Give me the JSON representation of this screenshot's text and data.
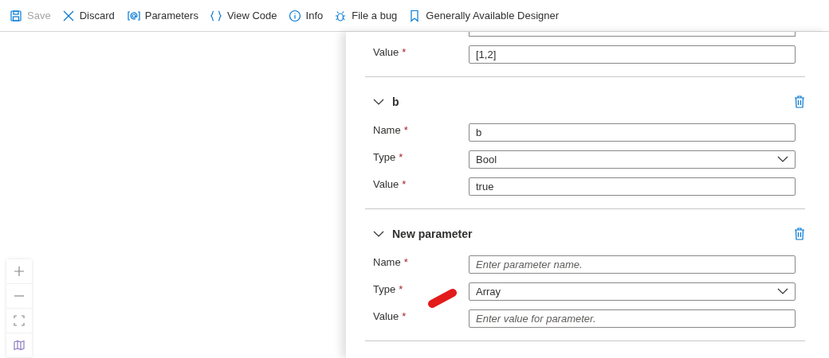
{
  "toolbar": [
    {
      "kind": "save",
      "label": "Save",
      "disabled": true
    },
    {
      "kind": "discard",
      "label": "Discard",
      "disabled": false
    },
    {
      "kind": "parameters",
      "label": "Parameters",
      "disabled": false
    },
    {
      "kind": "code",
      "label": "View Code",
      "disabled": false
    },
    {
      "kind": "info",
      "label": "Info",
      "disabled": false
    },
    {
      "kind": "bug",
      "label": "File a bug",
      "disabled": false
    },
    {
      "kind": "bookmark",
      "label": "Generally Available Designer",
      "disabled": false
    }
  ],
  "partial_section": {
    "fields": [
      {
        "kind": "text",
        "label": "Value",
        "required_mark": "*",
        "value": "[1,2]"
      }
    ]
  },
  "sections": [
    {
      "title": "b",
      "expanded": true,
      "fields": [
        {
          "kind": "text",
          "label": "Name",
          "required_mark": "*",
          "value": "b"
        },
        {
          "kind": "select",
          "label": "Type",
          "required_mark": "*",
          "value": "Bool"
        },
        {
          "kind": "text",
          "label": "Value",
          "required_mark": "*",
          "value": "true"
        }
      ]
    },
    {
      "title": "New parameter",
      "expanded": true,
      "fields": [
        {
          "kind": "text",
          "label": "Name",
          "required_mark": "*",
          "placeholder": "Enter parameter name."
        },
        {
          "kind": "select",
          "label": "Type",
          "required_mark": "*",
          "value": "Array"
        },
        {
          "kind": "text",
          "label": "Value",
          "required_mark": "*",
          "placeholder": "Enter value for parameter."
        }
      ]
    }
  ],
  "canvas_controls": [
    {
      "kind": "zoom_in"
    },
    {
      "kind": "zoom_out"
    },
    {
      "kind": "fit"
    },
    {
      "kind": "minimap"
    }
  ]
}
